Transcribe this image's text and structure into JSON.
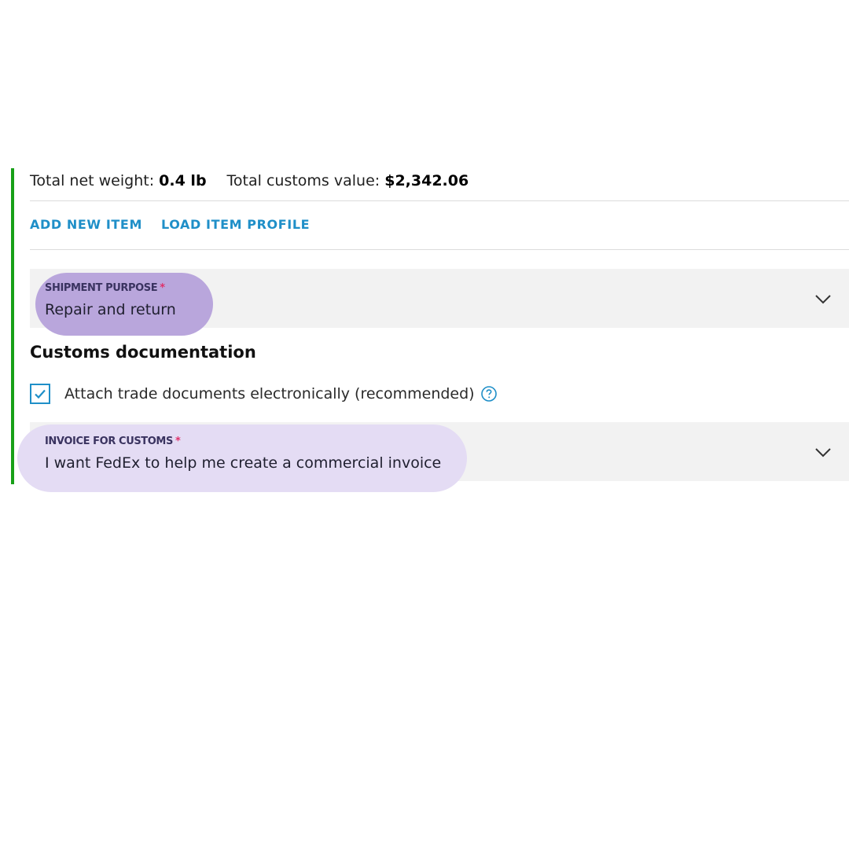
{
  "totals": {
    "net_weight_label": "Total net weight:",
    "net_weight_value": "0.4 lb",
    "customs_value_label": "Total customs value:",
    "customs_value_value": "$2,342.06"
  },
  "actions": {
    "add_new_item": "ADD NEW ITEM",
    "load_item_profile": "LOAD ITEM PROFILE"
  },
  "shipment_purpose": {
    "label": "SHIPMENT PURPOSE",
    "required_mark": "*",
    "value": "Repair and return"
  },
  "customs_documentation": {
    "title": "Customs documentation",
    "attach_checkbox_label": "Attach trade documents electronically (recommended)",
    "attach_checked": true
  },
  "invoice_for_customs": {
    "label": "INVOICE FOR CUSTOMS",
    "required_mark": "*",
    "value": "I want FedEx to help me create a commercial invoice"
  },
  "colors": {
    "accent_bar": "#18a018",
    "link": "#1f8fc8",
    "highlight_purpose": "#b9a6dc",
    "highlight_invoice": "#e4dcf4",
    "required": "#e0306a"
  },
  "icons": [
    "chevron-down-icon",
    "checkmark-icon",
    "help-circle-icon"
  ]
}
